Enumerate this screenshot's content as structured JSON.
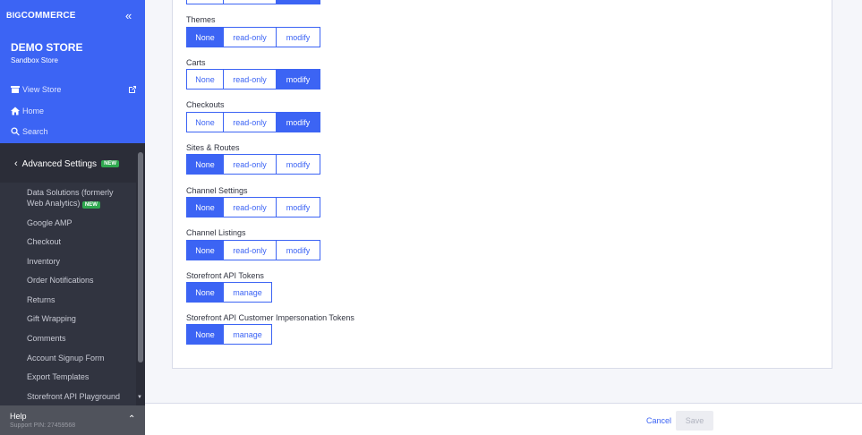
{
  "brand": {
    "logo_prefix": "BIG",
    "logo_text": "COMMERCE"
  },
  "store": {
    "name": "DEMO STORE",
    "subtitle": "Sandbox Store"
  },
  "nav": {
    "view_store": "View Store",
    "home": "Home",
    "search": "Search"
  },
  "advanced": {
    "label": "Advanced Settings",
    "badge": "NEW"
  },
  "submenu": [
    {
      "label": "Data Solutions (formerly",
      "label2": "Web Analytics)",
      "badge": "NEW"
    },
    {
      "label": "Google AMP"
    },
    {
      "label": "Checkout"
    },
    {
      "label": "Inventory"
    },
    {
      "label": "Order Notifications"
    },
    {
      "label": "Returns"
    },
    {
      "label": "Gift Wrapping"
    },
    {
      "label": "Comments"
    },
    {
      "label": "Account Signup Form"
    },
    {
      "label": "Export Templates"
    },
    {
      "label": "Storefront API Playground"
    }
  ],
  "help": {
    "title": "Help",
    "pin": "Support PIN: 27459568"
  },
  "options": {
    "none": "None",
    "read_only": "read-only",
    "modify": "modify",
    "manage": "manage"
  },
  "permissions": [
    {
      "label": "",
      "selected": "modify"
    },
    {
      "label": "Themes",
      "selected": "none"
    },
    {
      "label": "Carts",
      "selected": "modify"
    },
    {
      "label": "Checkouts",
      "selected": "modify"
    },
    {
      "label": "Sites & Routes",
      "selected": "none"
    },
    {
      "label": "Channel Settings",
      "selected": "none"
    },
    {
      "label": "Channel Listings",
      "selected": "none"
    },
    {
      "label": "Storefront API Tokens",
      "selected": "none"
    },
    {
      "label": "Storefront API Customer Impersonation Tokens",
      "selected": "none"
    }
  ],
  "footer": {
    "cancel": "Cancel",
    "save": "Save"
  },
  "colors": {
    "primary": "#3c64f4",
    "sidebar": "#313440",
    "success": "#2fa84f"
  }
}
